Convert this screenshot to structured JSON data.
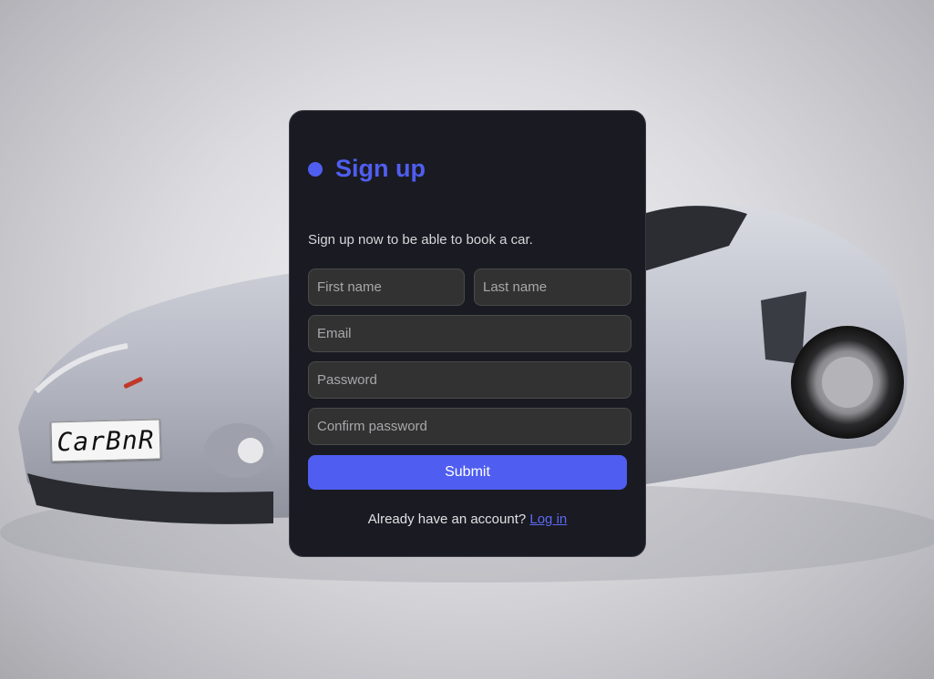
{
  "background": {
    "license_plate_text": "CarBnR"
  },
  "signup": {
    "title": "Sign up",
    "subtitle": "Sign up now to be able to book a car.",
    "fields": {
      "first_name_placeholder": "First name",
      "last_name_placeholder": "Last name",
      "email_placeholder": "Email",
      "password_placeholder": "Password",
      "confirm_password_placeholder": "Confirm password"
    },
    "submit_label": "Submit",
    "footer_text": "Already have an account?",
    "login_link_label": "Log in"
  },
  "colors": {
    "accent": "#4f5ef0",
    "card_background": "#1a1a22",
    "input_background": "#323232"
  }
}
